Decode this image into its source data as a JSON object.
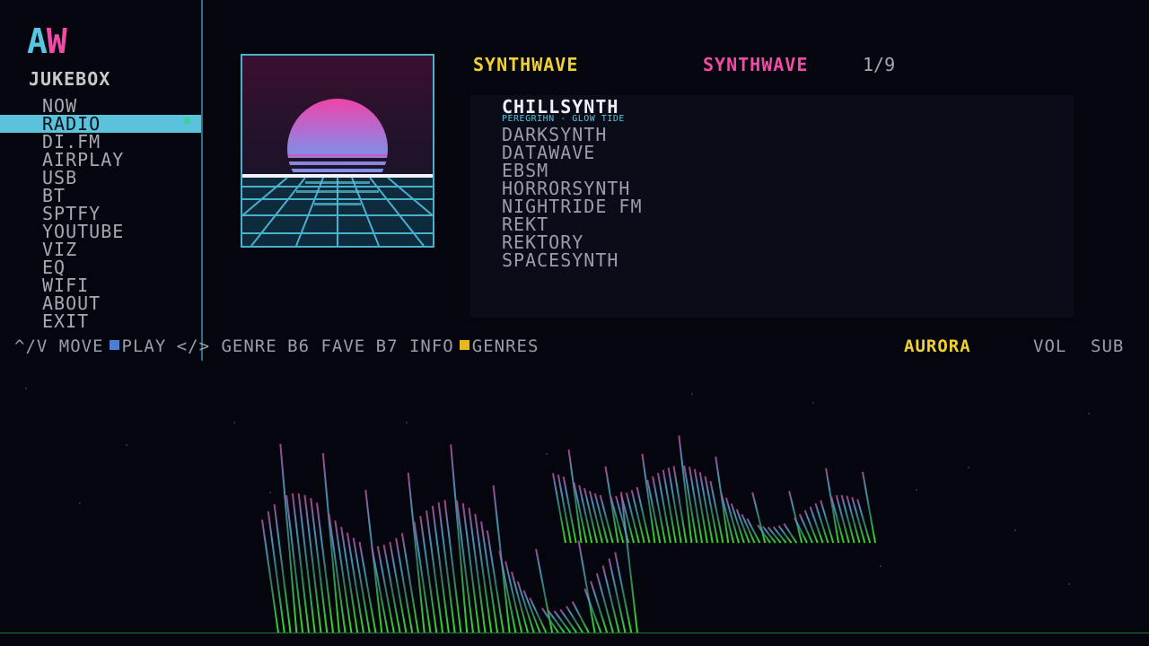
{
  "sidebar": {
    "logo_left": "A",
    "logo_right": "W",
    "title": "JUKEBOX",
    "items": [
      {
        "label": "NOW",
        "active": false
      },
      {
        "label": "RADIO",
        "active": true
      },
      {
        "label": "DI.FM",
        "active": false
      },
      {
        "label": "AIRPLAY",
        "active": false
      },
      {
        "label": "USB",
        "active": false
      },
      {
        "label": "BT",
        "active": false
      },
      {
        "label": "SPTFY",
        "active": false
      },
      {
        "label": "YOUTUBE",
        "active": false
      },
      {
        "label": "VIZ",
        "active": false
      },
      {
        "label": "EQ",
        "active": false
      },
      {
        "label": "WIFI",
        "active": false
      },
      {
        "label": "ABOUT",
        "active": false
      },
      {
        "label": "EXIT",
        "active": false
      }
    ]
  },
  "genre": {
    "left": "SYNTHWAVE",
    "right": "SYNTHWAVE",
    "count": "1/9"
  },
  "stations": {
    "current": "CHILLSYNTH",
    "now_playing": "PEREGRIHN - GLOW TIDE",
    "items": [
      "DARKSYNTH",
      "DATAWAVE",
      "EBSM",
      "HORRORSYNTH",
      "NIGHTRIDE FM",
      "REKT",
      "REKTORY",
      "SPACESYNTH"
    ]
  },
  "hints": {
    "move": "^/V MOVE",
    "play": "PLAY",
    "genre": "</> GENRE",
    "fave": "B6 FAVE",
    "info": "B7 INFO",
    "genres": "GENRES"
  },
  "status": {
    "station": "AURORA",
    "vol": "VOL",
    "sub": "SUB"
  },
  "colors": {
    "accent_cyan": "#5bc2dc",
    "accent_pink": "#f04ba7",
    "accent_yellow": "#f2d12c",
    "viz_green": "#3dff2a"
  },
  "icons": {
    "album_art": "synthwave-sunset-grid",
    "play_key": "blue-square",
    "genres_key": "yellow-square"
  }
}
